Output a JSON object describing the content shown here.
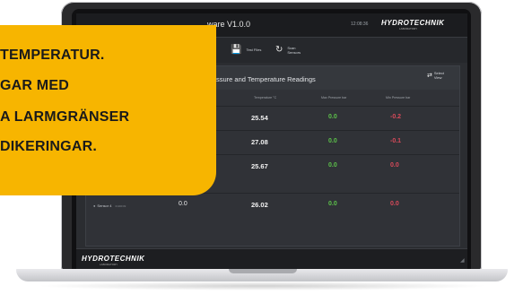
{
  "app": {
    "title": "ware V1.0.0",
    "time": "12:08:36",
    "brand": "HYDROTECHNIK",
    "brand_sub": "LABORATORY"
  },
  "toolbar": {
    "test_files_label": "Test Files",
    "scan_sensors_label": "Scan\nSensors"
  },
  "panel": {
    "title": "ssure and Temperature Readings",
    "select_view_label": "Select\nView",
    "columns": {
      "temperature": "Temperature °C",
      "max_pressure": "Max Pressure bar",
      "min_pressure": "Min Pressure bar"
    },
    "rows": [
      {
        "name": "",
        "id": "",
        "pressure": "",
        "temperature": "25.54",
        "max_pressure": "0.0",
        "min_pressure": "-0.2"
      },
      {
        "name": "",
        "id": "",
        "pressure": "",
        "temperature": "27.08",
        "max_pressure": "0.0",
        "min_pressure": "-0.1"
      },
      {
        "name": "",
        "id": "",
        "pressure": "",
        "temperature": "25.67",
        "max_pressure": "0.0",
        "min_pressure": "0.0"
      },
      {
        "name": "Sensor 4",
        "id": "0190F09",
        "pressure": "0.0",
        "temperature": "26.02",
        "max_pressure": "0.0",
        "min_pressure": "0.0"
      }
    ]
  },
  "footer": {
    "brand": "HYDROTECHNIK",
    "brand_sub": "LABORATORY"
  },
  "callout": {
    "lines": [
      "TEMPERATUR.",
      "GAR MED",
      "A LARMGRÄNSER",
      "DIKERINGAR."
    ]
  },
  "colors": {
    "callout_bg": "#f7b500",
    "max_pressure_green": "#5cc24a",
    "min_pressure_red": "#d84a5a"
  }
}
